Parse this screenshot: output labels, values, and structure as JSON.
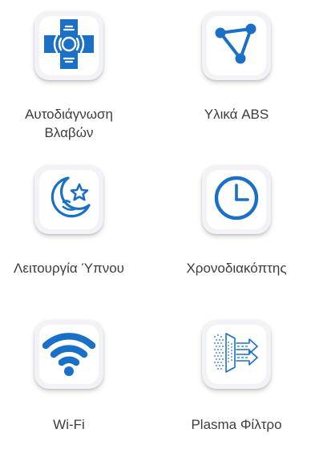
{
  "colors": {
    "accent": "#1a6fc7",
    "label_text": "#3d3d3d",
    "tile_bg": "#ffffff"
  },
  "features": [
    {
      "icon": "self-diagnosis-cross-icon",
      "label_lines": [
        "Αυτοδιάγνωση",
        "Βλαβών"
      ]
    },
    {
      "icon": "abs-material-triangle-icon",
      "label_lines": [
        "Υλικά ABS"
      ]
    },
    {
      "icon": "sleep-moon-star-icon",
      "label_lines": [
        "Λειτουργία Ύπνου"
      ]
    },
    {
      "icon": "timer-clock-icon",
      "label_lines": [
        "Χρονοδιακόπτης"
      ]
    },
    {
      "icon": "wifi-icon",
      "label_lines": [
        "Wi-Fi"
      ]
    },
    {
      "icon": "plasma-filter-icon",
      "label_lines": [
        "Plasma Φίλτρο"
      ]
    }
  ]
}
